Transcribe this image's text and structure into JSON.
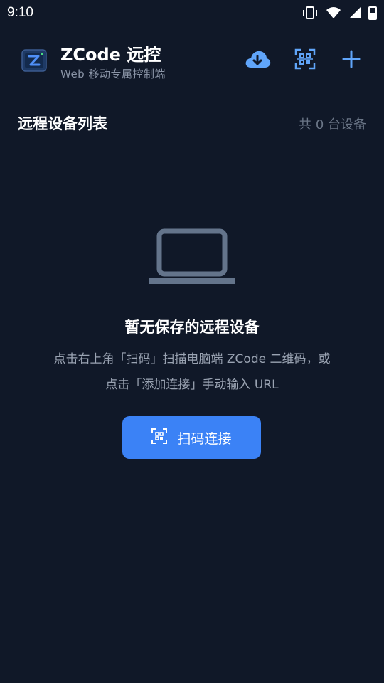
{
  "status_bar": {
    "time": "9:10",
    "icons": [
      "vibrate-icon",
      "wifi-icon",
      "signal-icon",
      "battery-icon"
    ]
  },
  "header": {
    "title": "ZCode 远控",
    "subtitle": "Web 移动专属控制端",
    "actions": [
      {
        "name": "cloud-download-icon"
      },
      {
        "name": "qr-scan-icon"
      },
      {
        "name": "plus-icon"
      }
    ]
  },
  "section": {
    "title": "远程设备列表",
    "count_text": "共 0 台设备"
  },
  "empty_state": {
    "icon": "laptop-icon",
    "title": "暂无保存的远程设备",
    "description": "点击右上角「扫码」扫描电脑端 ZCode 二维码，或点击「添加连接」手动输入 URL",
    "button_label": "扫码连接"
  },
  "colors": {
    "background": "#101828",
    "accent": "#3b82f6",
    "icon_muted": "#64748b",
    "text_secondary": "#9aa3b2"
  }
}
